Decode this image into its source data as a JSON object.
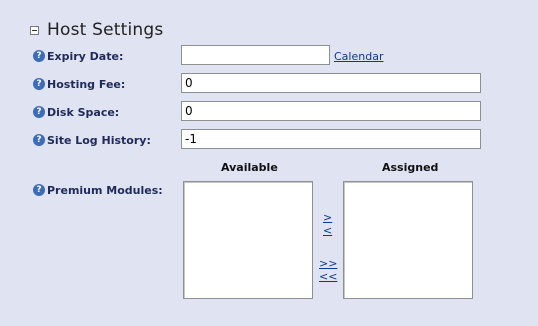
{
  "section": {
    "title": "Host Settings"
  },
  "fields": {
    "expiry_date": {
      "label": "Expiry Date:",
      "value": ""
    },
    "calendar_link": "Calendar",
    "hosting_fee": {
      "label": "Hosting Fee:",
      "value": "0"
    },
    "disk_space": {
      "label": "Disk Space:",
      "value": "0"
    },
    "site_log_history": {
      "label": "Site Log History:",
      "value": "-1"
    },
    "premium_modules": {
      "label": "Premium Modules:"
    }
  },
  "modules": {
    "available_header": "Available",
    "assigned_header": "Assigned",
    "add_one": ">",
    "remove_one": "<",
    "add_all": ">>",
    "remove_all": "<<",
    "available_items": [],
    "assigned_items": []
  },
  "icons": {
    "help": "help-icon",
    "toggle": "collapse-minus-icon"
  },
  "colors": {
    "background": "#dfe3f2",
    "label": "#1f2a5a",
    "link": "#0b3a8a",
    "help_icon": "#3d6cb8"
  }
}
